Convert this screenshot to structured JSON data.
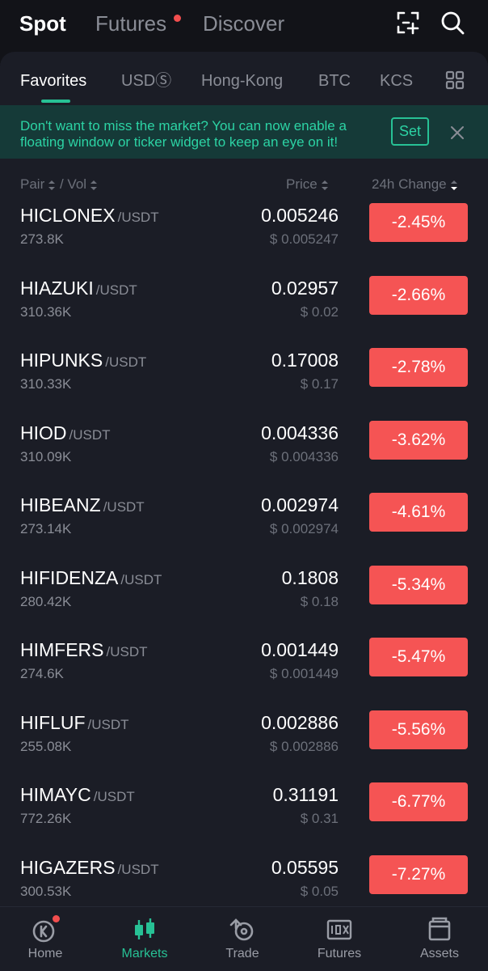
{
  "top_tabs": [
    {
      "label": "Spot",
      "active": true
    },
    {
      "label": "Futures",
      "active": false,
      "has_dot": true
    },
    {
      "label": "Discover",
      "active": false
    }
  ],
  "header_icons": [
    "scan-add-icon",
    "search-icon"
  ],
  "category_tabs": [
    {
      "label": "Favorites",
      "active": true
    },
    {
      "label": "USDⓈ",
      "active": false
    },
    {
      "label": "Hong-Kong",
      "active": false
    },
    {
      "label": "BTC",
      "active": false
    },
    {
      "label": "KCS",
      "active": false
    }
  ],
  "banner": {
    "text": "Don't want to miss the market? You can now enable a floating window or ticker widget to keep an eye on it!",
    "set_label": "Set"
  },
  "columns": {
    "pair": "Pair",
    "vol": "/ Vol",
    "price": "Price",
    "change": "24h Change"
  },
  "rows": [
    {
      "pair": "HICLONEX",
      "quote": "/USDT",
      "vol": "273.8K",
      "price": "0.005246",
      "price_usd": "$ 0.005247",
      "change": "-2.45%"
    },
    {
      "pair": "HIAZUKI",
      "quote": "/USDT",
      "vol": "310.36K",
      "price": "0.02957",
      "price_usd": "$ 0.02",
      "change": "-2.66%"
    },
    {
      "pair": "HIPUNKS",
      "quote": "/USDT",
      "vol": "310.33K",
      "price": "0.17008",
      "price_usd": "$ 0.17",
      "change": "-2.78%"
    },
    {
      "pair": "HIOD",
      "quote": "/USDT",
      "vol": "310.09K",
      "price": "0.004336",
      "price_usd": "$ 0.004336",
      "change": "-3.62%"
    },
    {
      "pair": "HIBEANZ",
      "quote": "/USDT",
      "vol": "273.14K",
      "price": "0.002974",
      "price_usd": "$ 0.002974",
      "change": "-4.61%"
    },
    {
      "pair": "HIFIDENZA",
      "quote": "/USDT",
      "vol": "280.42K",
      "price": "0.1808",
      "price_usd": "$ 0.18",
      "change": "-5.34%"
    },
    {
      "pair": "HIMFERS",
      "quote": "/USDT",
      "vol": "274.6K",
      "price": "0.001449",
      "price_usd": "$ 0.001449",
      "change": "-5.47%"
    },
    {
      "pair": "HIFLUF",
      "quote": "/USDT",
      "vol": "255.08K",
      "price": "0.002886",
      "price_usd": "$ 0.002886",
      "change": "-5.56%"
    },
    {
      "pair": "HIMAYC",
      "quote": "/USDT",
      "vol": "772.26K",
      "price": "0.31191",
      "price_usd": "$ 0.31",
      "change": "-6.77%"
    },
    {
      "pair": "HIGAZERS",
      "quote": "/USDT",
      "vol": "300.53K",
      "price": "0.05595",
      "price_usd": "$ 0.05",
      "change": "-7.27%"
    }
  ],
  "bottom_nav": [
    {
      "label": "Home",
      "icon": "home-coin-icon",
      "active": false,
      "has_dot": true
    },
    {
      "label": "Markets",
      "icon": "candlestick-icon",
      "active": true
    },
    {
      "label": "Trade",
      "icon": "trade-swap-icon",
      "active": false
    },
    {
      "label": "Futures",
      "icon": "futures-100x-icon",
      "active": false
    },
    {
      "label": "Assets",
      "icon": "wallet-icon",
      "active": false
    }
  ],
  "colors": {
    "background": "#121318",
    "panel": "#1b1d26",
    "accent": "#27c195",
    "negative": "#f55454",
    "banner_bg": "#153a38"
  }
}
